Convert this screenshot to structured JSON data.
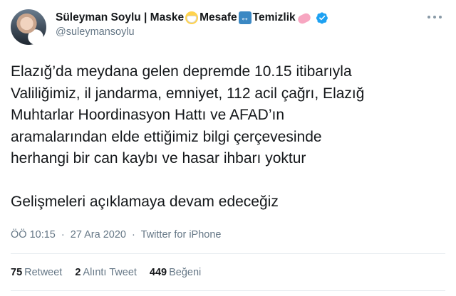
{
  "author": {
    "name_part1": "Süleyman Soylu | Maske",
    "name_part2": "Mesafe",
    "name_part3": "Temizlik",
    "handle": "@suleymansoylu",
    "verified": true
  },
  "icons": {
    "name_emojis": [
      "face-with-mask-icon",
      "left-right-arrow-icon",
      "soap-icon"
    ],
    "verified": "verified-badge-icon",
    "more": "more-options-icon"
  },
  "tweet": {
    "paragraph1": "Elazığ’da meydana gelen depremde 10.15 itibarıyla\nValiliğimiz, il jandarma, emniyet, 112 acil çağrı, Elazığ\nMuhtarlar Hoordinasyon Hattı ve AFAD’ın\naramalarından elde ettiğimiz bilgi çerçevesinde\nherhangi bir can kaybı ve hasar ihbarı yoktur",
    "paragraph2": "Gelişmeleri açıklamaya devam edeceğiz"
  },
  "meta": {
    "time": "ÖÖ 10:15",
    "date": "27 Ara 2020",
    "source": "Twitter for iPhone",
    "separator": "·"
  },
  "stats": {
    "retweets": "75",
    "retweets_label": "Retweet",
    "quotes": "2",
    "quotes_label": "Alıntı Tweet",
    "likes": "449",
    "likes_label": "Beğeni"
  },
  "colors": {
    "text": "#14171a",
    "secondary": "#657786",
    "verified": "#1da1f2",
    "divider": "#e6ecf0"
  }
}
